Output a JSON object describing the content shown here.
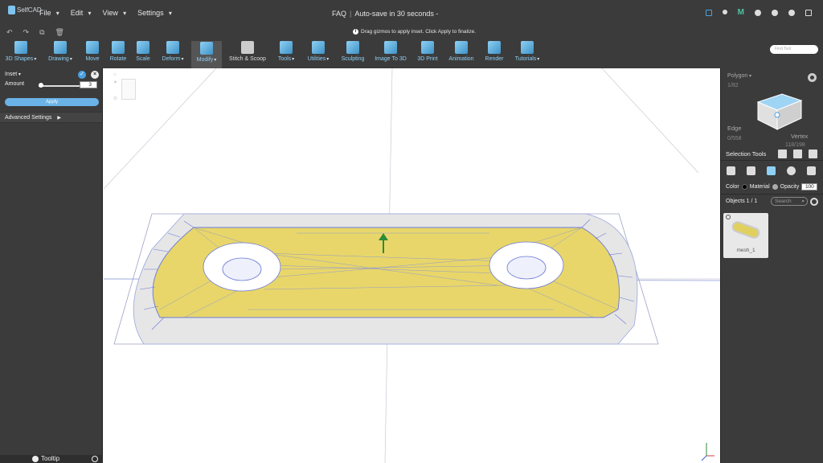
{
  "app": {
    "logo_text": "SelfCAD"
  },
  "menu": [
    "File",
    "Edit",
    "View",
    "Settings"
  ],
  "header": {
    "faq": "FAQ",
    "autosave": "Auto-save in 30 seconds -"
  },
  "hint": {
    "text": "Drag gizmos to apply inset. Click Apply to finalize."
  },
  "toolbar": {
    "tools": [
      {
        "label": "3D Shapes",
        "icon": "cube-icon"
      },
      {
        "label": "Drawing",
        "icon": "pencil-icon"
      },
      {
        "label": "Move",
        "icon": "move-icon"
      },
      {
        "label": "Rotate",
        "icon": "rotate-icon"
      },
      {
        "label": "Scale",
        "icon": "scale-icon"
      },
      {
        "label": "Deform",
        "icon": "deform-icon"
      },
      {
        "label": "Modify",
        "icon": "modify-icon"
      },
      {
        "label": "Stitch & Scoop",
        "icon": "stitch-icon"
      },
      {
        "label": "Tools",
        "icon": "tools-icon"
      },
      {
        "label": "Utilities",
        "icon": "utilities-icon"
      },
      {
        "label": "Sculpting",
        "icon": "sculpting-icon"
      },
      {
        "label": "Image To 3D",
        "icon": "image-to-3d-icon"
      },
      {
        "label": "3D Print",
        "icon": "print-icon"
      },
      {
        "label": "Animation",
        "icon": "animation-icon"
      },
      {
        "label": "Render",
        "icon": "render-icon"
      },
      {
        "label": "Tutorials",
        "icon": "tutorials-icon"
      }
    ],
    "find_placeholder": "Find Tool"
  },
  "left_panel": {
    "tool_name": "Inset",
    "amount_label": "Amount",
    "amount_value": "3",
    "apply_label": "Apply",
    "advanced_label": "Advanced Settings",
    "tooltip_label": "Tooltip"
  },
  "right_panel": {
    "mode": "Polygon",
    "polygon_count": "1/82",
    "edge_label": "Edge",
    "edge_count": "0/558",
    "vertex_label": "Vertex",
    "vertex_count": "118/198",
    "selection_tools_label": "Selection Tools",
    "color_label": "Color",
    "material_label": "Material",
    "opacity_label": "Opacity",
    "opacity_value": "100",
    "objects_label": "Objects 1 / 1",
    "search_placeholder": "Search",
    "object_name": "mesh_1"
  },
  "colors": {
    "panel_bg": "#3b3b3b",
    "accent": "#4aa0e0",
    "face_selected": "#e8d66a",
    "wire": "#5b6fd9"
  }
}
